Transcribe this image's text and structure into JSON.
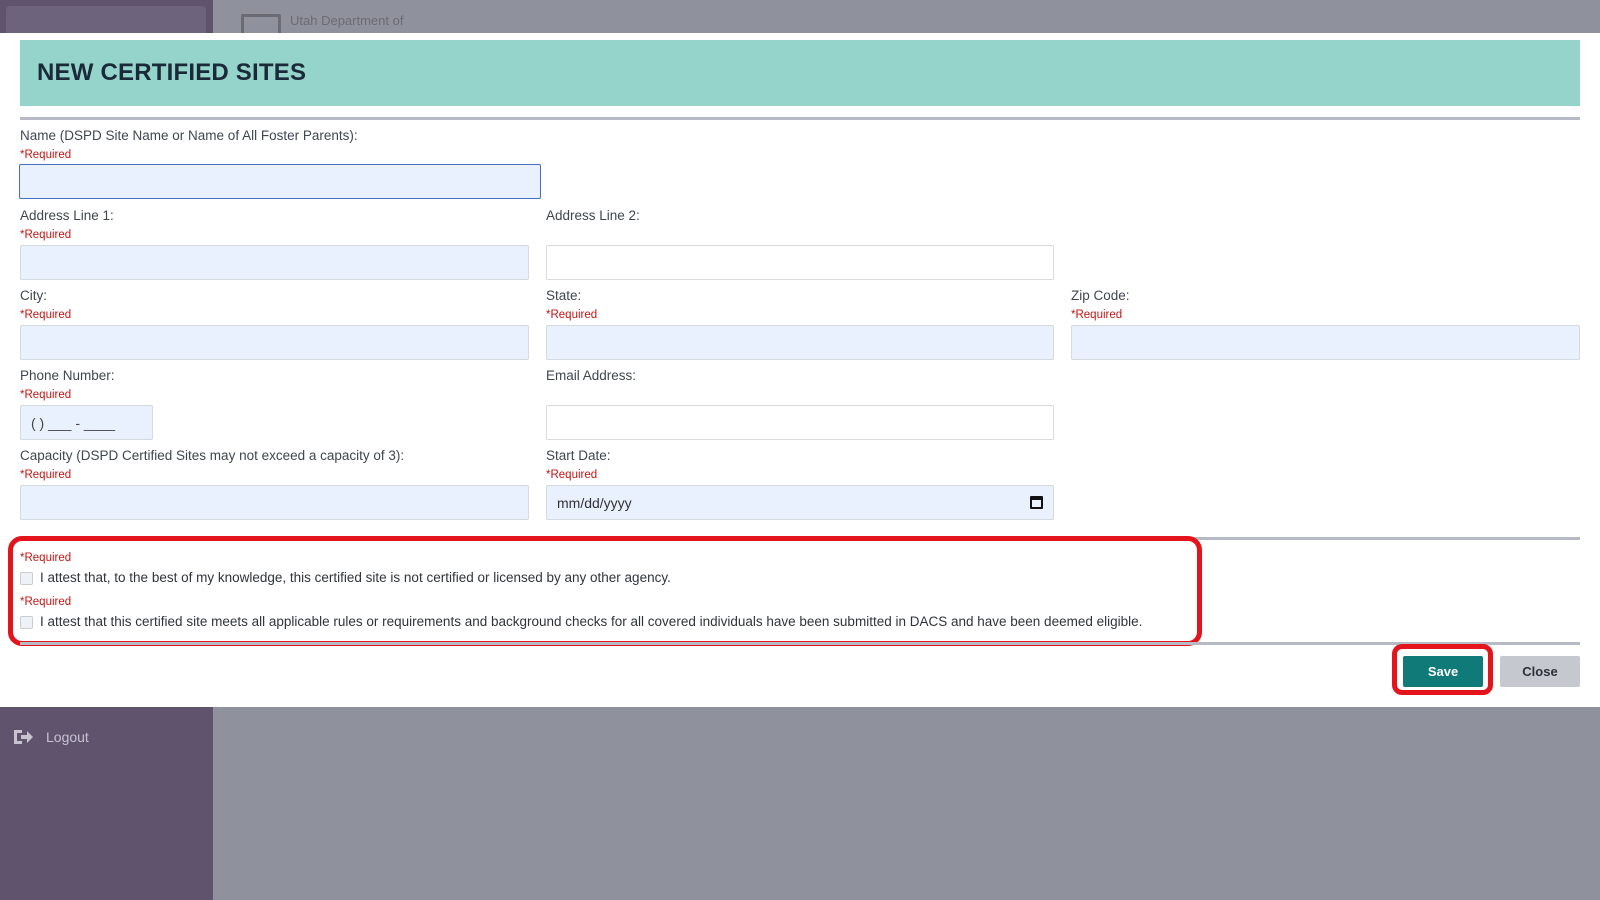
{
  "background": {
    "header_text": "Utah Department of",
    "logout_label": "Logout"
  },
  "modal": {
    "title": "NEW CERTIFIED SITES",
    "required_marker": "*Required",
    "fields": {
      "name": {
        "label": "Name (DSPD Site Name or Name of All Foster Parents):",
        "value": ""
      },
      "address1": {
        "label": "Address Line 1:",
        "value": ""
      },
      "address2": {
        "label": "Address Line 2:",
        "value": ""
      },
      "city": {
        "label": "City:",
        "value": ""
      },
      "state": {
        "label": "State:",
        "value": ""
      },
      "zip": {
        "label": "Zip Code:",
        "value": ""
      },
      "phone": {
        "label": "Phone Number:",
        "placeholder": "(  ) ___ - ____"
      },
      "email": {
        "label": "Email Address:",
        "value": ""
      },
      "capacity": {
        "label": "Capacity (DSPD Certified Sites may not exceed a capacity of 3):",
        "value": ""
      },
      "start_date": {
        "label": "Start Date:",
        "placeholder": "mm/dd/yyyy"
      }
    },
    "attestations": [
      {
        "text": "I attest that, to the best of my knowledge, this certified site is not certified or licensed by any other agency.",
        "checked": false
      },
      {
        "text": "I attest that this certified site meets all applicable rules or requirements and background checks for all covered individuals have been submitted in DACS and have been deemed eligible.",
        "checked": false
      }
    ],
    "buttons": {
      "save": "Save",
      "close": "Close"
    }
  },
  "colors": {
    "header_bg": "#95d4cb",
    "save_bg": "#0f7a78",
    "required_text": "#c01616",
    "highlight": "#e3141b"
  }
}
